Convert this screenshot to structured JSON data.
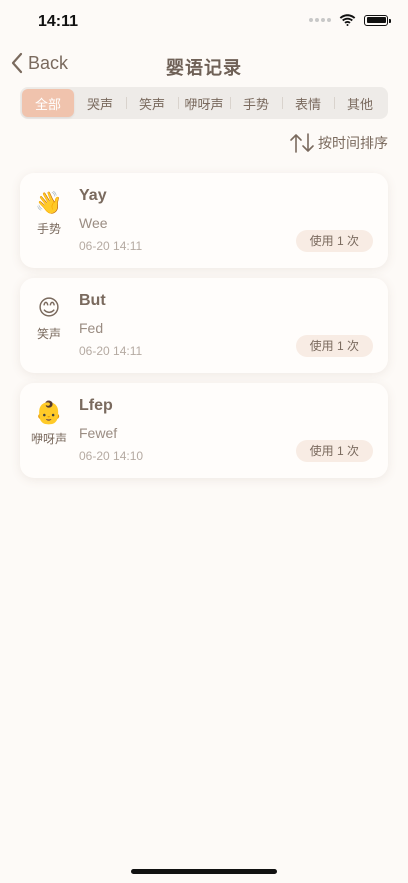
{
  "status": {
    "time": "14:11"
  },
  "nav": {
    "back_label": "Back",
    "title": "婴语记录"
  },
  "tabs": [
    {
      "label": "全部",
      "active": true
    },
    {
      "label": "哭声",
      "active": false
    },
    {
      "label": "笑声",
      "active": false
    },
    {
      "label": "咿呀声",
      "active": false
    },
    {
      "label": "手势",
      "active": false
    },
    {
      "label": "表情",
      "active": false
    },
    {
      "label": "其他",
      "active": false
    }
  ],
  "sort": {
    "label": "按时间排序"
  },
  "records": [
    {
      "emoji": "👋",
      "category": "手势",
      "title": "Yay",
      "description": "Wee",
      "time": "06-20 14:11",
      "usage": "使用 1 次"
    },
    {
      "emoji": "😊",
      "category": "笑声",
      "title": "But",
      "description": "Fed",
      "time": "06-20 14:11",
      "usage": "使用 1 次"
    },
    {
      "emoji": "👶",
      "category": "咿呀声",
      "title": "Lfep",
      "description": "Fewef",
      "time": "06-20 14:10",
      "usage": "使用 1 次"
    }
  ],
  "colors": {
    "accent": "#f0c3ad",
    "text": "#7a6a5e",
    "background": "#fdfaf7"
  }
}
